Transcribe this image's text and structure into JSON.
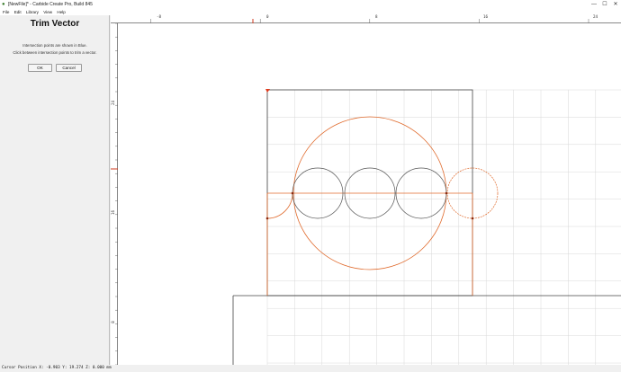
{
  "window": {
    "title": "[NewFile]* - Carbide Create Pro, Build 845",
    "minimize": "—",
    "maximize": "☐",
    "close": "✕"
  },
  "menu": {
    "file": "File",
    "edit": "Edit",
    "library": "Library",
    "view": "View",
    "help": "Help"
  },
  "panel": {
    "title": "Trim Vector",
    "line1": "Intersection points are shown in Blue.",
    "line2": "Click between intersection points to trim a vector.",
    "ok": "OK",
    "cancel": "Cancel"
  },
  "ruler_top": {
    "labels": [
      "-8",
      "0",
      "8",
      "16",
      "24"
    ]
  },
  "ruler_left": {
    "labels": [
      "24",
      "16",
      "8"
    ]
  },
  "status": {
    "cursor": "Cursor Position X: -0.903 Y: 19.274 Z: 0.000 mm"
  },
  "colors": {
    "vector_selected": "#e06a2c",
    "vector_normal": "#555555",
    "grid": "#d8d8d8",
    "stock_border": "#444444"
  }
}
